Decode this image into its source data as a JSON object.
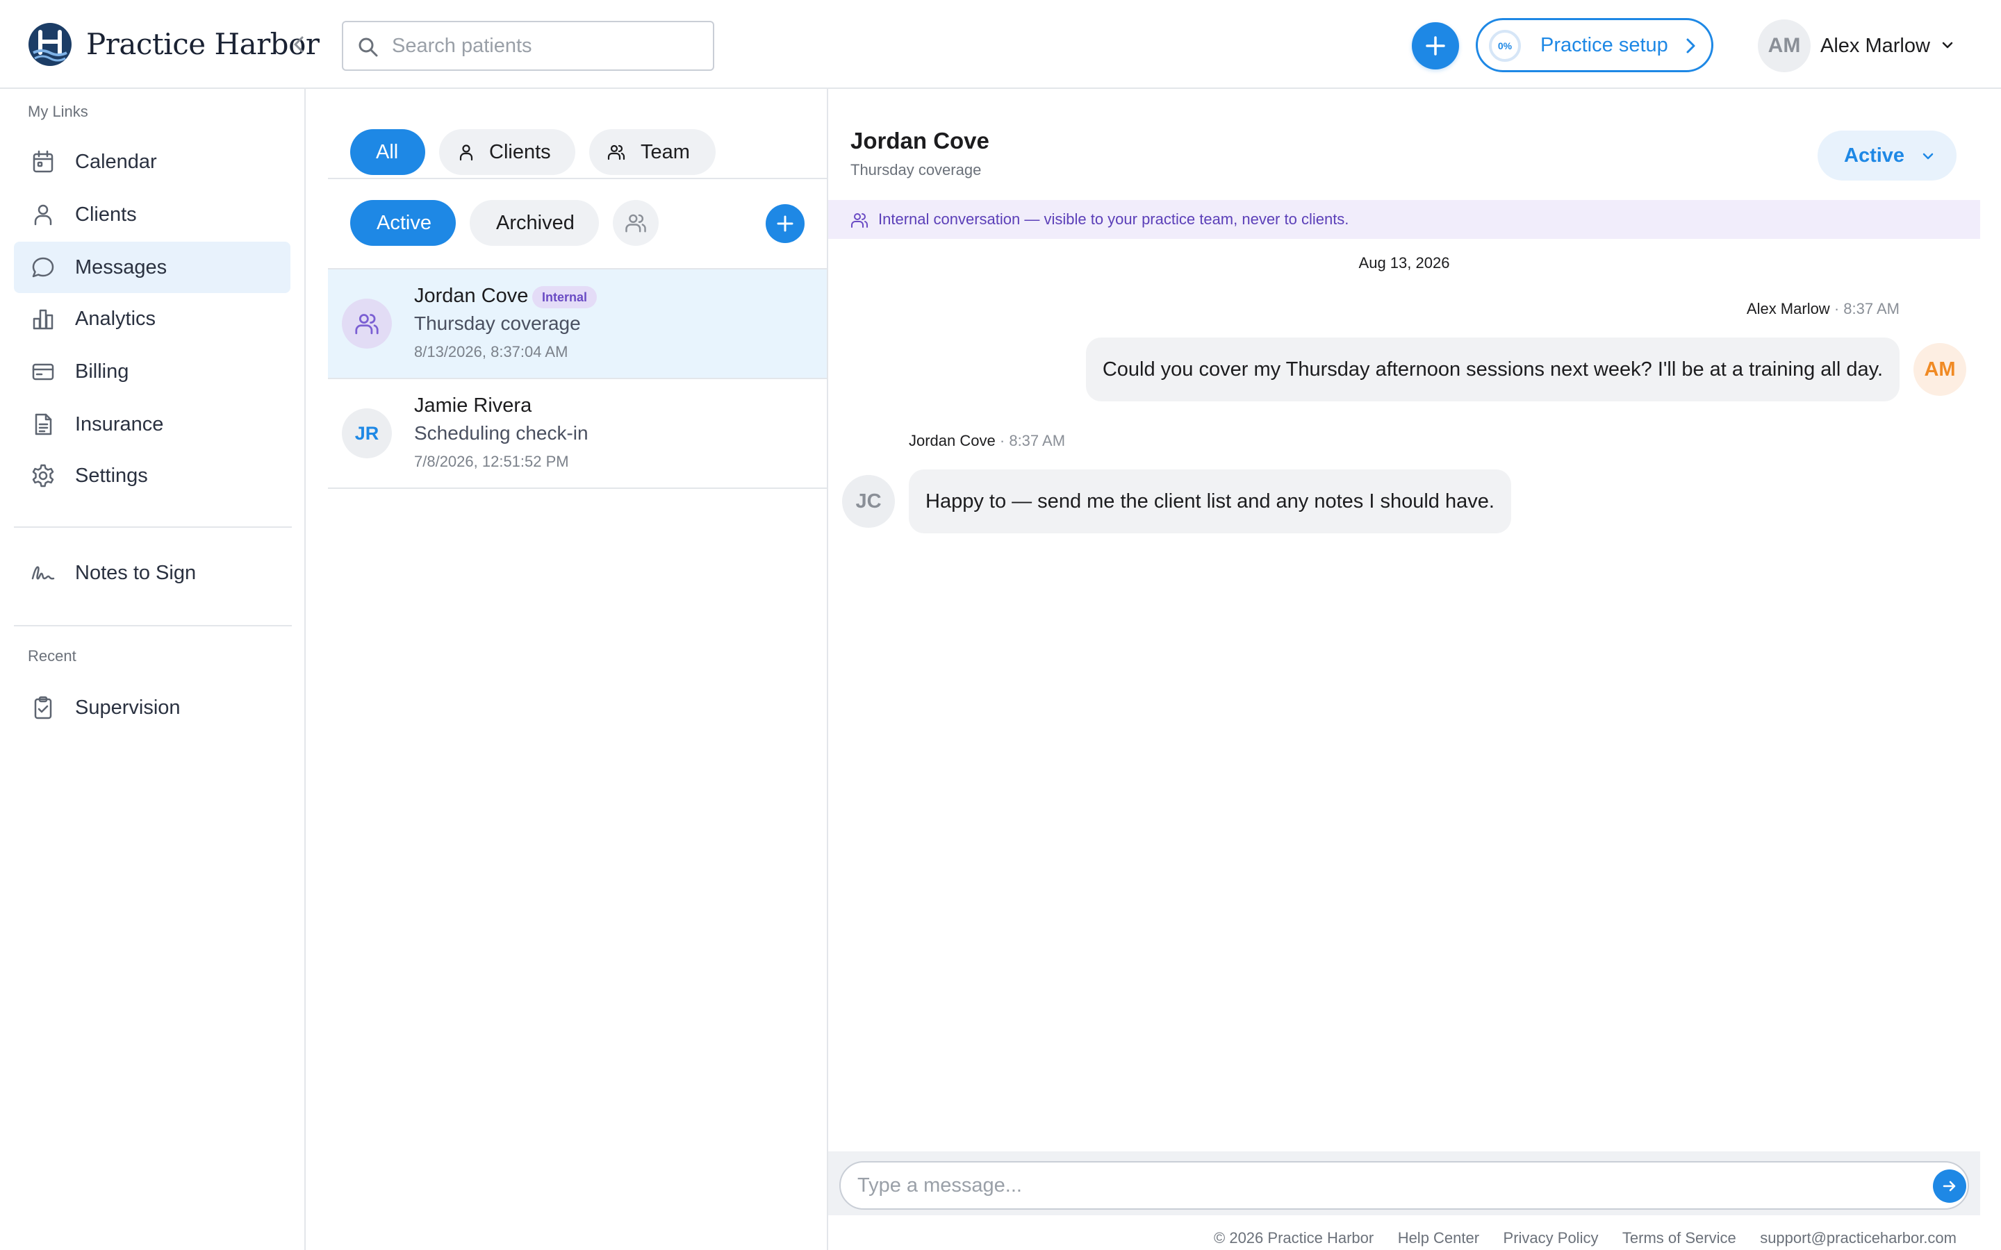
{
  "app": {
    "brand": "Practice Harbor",
    "accent_color": "#1e88e5",
    "internal_color": "#6a4bc4"
  },
  "topbar": {
    "search_placeholder": "Search patients",
    "setup_label": "Practice setup",
    "setup_percent": "0%",
    "setup_progress": 0,
    "user_initials": "AM",
    "user_name": "Alex Marlow"
  },
  "sidebar": {
    "my_links_heading": "My Links",
    "items": [
      {
        "label": "Calendar",
        "icon": "calendar-icon"
      },
      {
        "label": "Clients",
        "icon": "person-icon"
      },
      {
        "label": "Messages",
        "icon": "chat-bubble-icon",
        "active": true
      },
      {
        "label": "Analytics",
        "icon": "bar-chart-icon"
      },
      {
        "label": "Billing",
        "icon": "credit-card-icon"
      },
      {
        "label": "Insurance",
        "icon": "document-icon"
      },
      {
        "label": "Settings",
        "icon": "gear-icon"
      }
    ],
    "notes_label": "Notes to Sign",
    "recent_heading": "Recent",
    "recent_items": [
      {
        "label": "Supervision",
        "icon": "clipboard-check-icon"
      }
    ]
  },
  "conversation_list": {
    "filters": [
      {
        "label": "All",
        "selected": true
      },
      {
        "label": "Clients",
        "icon": "person-icon"
      },
      {
        "label": "Team",
        "icon": "people-icon"
      }
    ],
    "status_filters": [
      {
        "label": "Active",
        "selected": true
      },
      {
        "label": "Archived"
      }
    ],
    "conversations": [
      {
        "name": "Jordan Cove",
        "badge": "Internal",
        "subject": "Thursday coverage",
        "timestamp": "8/13/2026, 8:37:04 AM",
        "avatar_icon": "people-icon",
        "selected": true
      },
      {
        "name": "Jamie Rivera",
        "initials": "JR",
        "subject": "Scheduling check-in",
        "timestamp": "7/8/2026, 12:51:52 PM"
      }
    ]
  },
  "chat": {
    "title": "Jordan Cove",
    "subtitle": "Thursday coverage",
    "status": "Active",
    "banner": "Internal conversation — visible to your practice team, never to clients.",
    "date_separator": "Aug 13, 2026",
    "messages": [
      {
        "sender": "Alex Marlow",
        "time": "8:37 AM",
        "text": "Could you cover my Thursday afternoon sessions next week? I'll be at a training all day.",
        "initials": "AM",
        "outgoing": true
      },
      {
        "sender": "Jordan Cove",
        "time": "8:37 AM",
        "text": "Happy to — send me the client list and any notes I should have.",
        "initials": "JC",
        "outgoing": false
      }
    ],
    "composer_placeholder": "Type a message..."
  },
  "footer": {
    "copyright": "© 2026 Practice Harbor",
    "links": [
      "Help Center",
      "Privacy Policy",
      "Terms of Service"
    ],
    "email": "support@practiceharbor.com"
  }
}
